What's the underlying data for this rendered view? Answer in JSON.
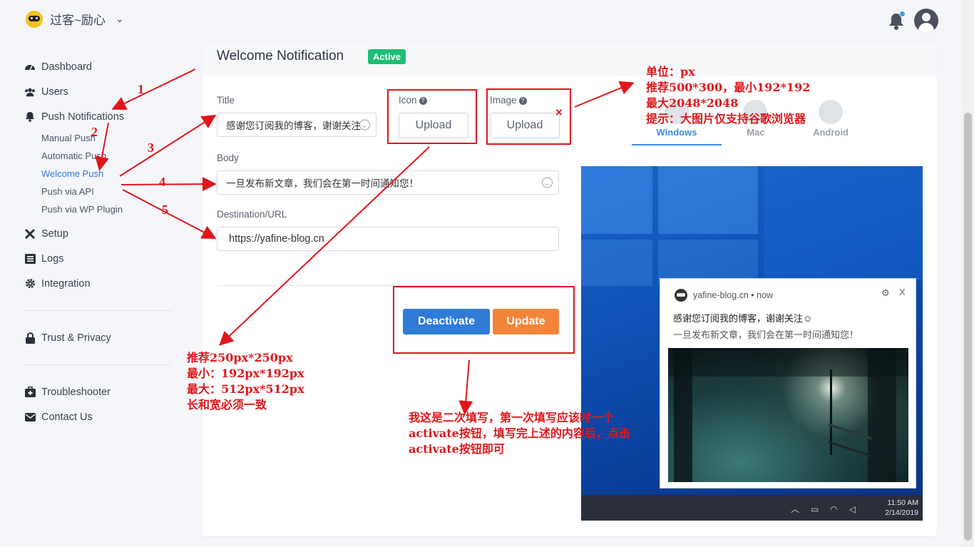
{
  "header": {
    "brand": "过客~励心",
    "brand_chevron": "⌄"
  },
  "sidebar": {
    "items": [
      {
        "label": "Dashboard",
        "icon": "dashboard-icon"
      },
      {
        "label": "Users",
        "icon": "users-icon"
      },
      {
        "label": "Push Notifications",
        "icon": "bell-icon"
      }
    ],
    "sub_items": [
      "Manual Push",
      "Automatic Push",
      "Welcome Push",
      "Push via API",
      "Push via WP Plugin"
    ],
    "items2": [
      {
        "label": "Setup",
        "icon": "wrench-icon"
      },
      {
        "label": "Logs",
        "icon": "list-icon"
      },
      {
        "label": "Integration",
        "icon": "gear-icon"
      }
    ],
    "trust": "Trust & Privacy",
    "troubleshooter": "Troubleshooter",
    "contact": "Contact Us"
  },
  "card": {
    "title": "Welcome Notification",
    "badge": "Active",
    "title_label": "Title",
    "title_value": "感谢您订阅我的博客，谢谢关注",
    "icon_label": "Icon",
    "image_label": "Image",
    "upload": "Upload",
    "remove_mark": "×",
    "body_label": "Body",
    "body_value": "一旦发布新文章，我们会在第一时间通知您！",
    "url_label": "Destination/URL",
    "url_value": "https://yafine-blog.cn",
    "deactivate": "Deactivate",
    "update": "Update"
  },
  "preview": {
    "tabs": [
      "Windows",
      "Mac",
      "Android"
    ],
    "active_tab": "Windows",
    "site": "yafine-blog.cn • now",
    "notif_title": "感谢您订阅我的博客，谢谢关注☺",
    "notif_body": "一旦发布新文章，我们会在第一时间通知您！",
    "close": "X",
    "time": "11:50 AM",
    "date": "2/14/2019"
  },
  "annotations": {
    "numbers": [
      "1",
      "2",
      "3",
      "4",
      "5"
    ],
    "image_note": [
      "单位：px",
      "推荐500*300，最小192*192",
      "最大2048*2048",
      "提示：大图片仅支持谷歌浏览器"
    ],
    "icon_note": [
      "推荐250px*250px",
      "最小：192px*192px",
      "最大：512px*512px",
      "长和宽必须一致"
    ],
    "button_note": [
      "我这是二次填写，第一次填写应该时一个",
      "activate按钮，填写完上述的内容后，点击",
      "activate按钮即可"
    ]
  },
  "colors": {
    "accent": "#2f7bd6",
    "active_badge": "#1dbf73",
    "deactivate": "#2f7bd6",
    "update": "#f2843a",
    "annotation": "#e0161b"
  }
}
